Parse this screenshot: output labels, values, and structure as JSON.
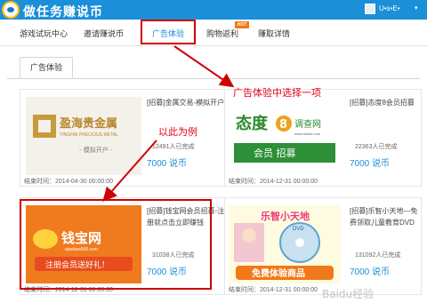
{
  "header": {
    "title": "做任务赚说币",
    "user_name": "U•s•E•",
    "caret": "▾"
  },
  "nav": {
    "items": [
      {
        "label": "游戏试玩中心"
      },
      {
        "label": "邀请赚说币"
      },
      {
        "label": "广告体验"
      },
      {
        "label": "购物返利"
      },
      {
        "label": "赚取详情"
      }
    ],
    "hot_badge": "HOT"
  },
  "subtab": {
    "label": "广告体验"
  },
  "cards": [
    {
      "title": "[招募]金属交易-模拟开户",
      "count": "12491人已完成",
      "price": "7000 说币",
      "end": "结束时间：2014-04-30 00:00:00",
      "image": {
        "brand": "盈海贵金属",
        "sub_en": "YINGHAI PRECIOUS METAL",
        "caption": "- 模拟开户 -"
      }
    },
    {
      "title": "[招募]态度8会员招募",
      "count": "22363人已完成",
      "price": "7000 说币",
      "end": "结束时间：2014-12-31 00:00:00",
      "image": {
        "brand_left": "态度",
        "brand_num": "8",
        "brand_right": "调查网",
        "url": "www.taidu8.com",
        "caption": "会员 招募"
      }
    },
    {
      "title": "[招募]钱宝网会员招募-注册就点击立即赚钱",
      "count": "31038人已完成",
      "price": "7000 说币",
      "end": "结束时间：2014-12-31 00:00:00",
      "image": {
        "brand": "钱宝网",
        "url": "qianbao666.com",
        "caption": "注册会员送好礼！"
      }
    },
    {
      "title": "[招募]乐智小天地—免费领取儿童教育DVD",
      "count": "131092人已完成",
      "price": "7000 说币",
      "end": "结束时间：2014-12-31 00:00:00",
      "image": {
        "brand": "乐智小天地",
        "disc": "DVD",
        "caption": "免费体验商品"
      }
    }
  ],
  "annotations": {
    "select_hint": "广告体验中选择一项",
    "example_hint": "以此为例"
  },
  "watermark": "Baidu经验"
}
